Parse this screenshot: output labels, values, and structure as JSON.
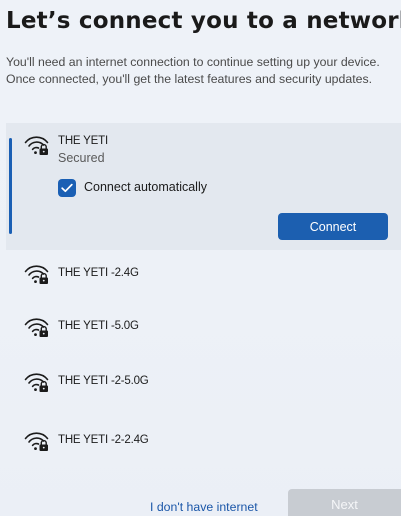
{
  "page": {
    "title": "Let’s connect you to a network",
    "subtitle": "You'll need an internet connection to continue setting up your device. Once connected, you'll get the latest features and security updates."
  },
  "selected_network": {
    "name": "THE YETI",
    "status": "Secured",
    "auto_connect_label": "Connect automatically",
    "auto_connect_checked": true,
    "connect_label": "Connect",
    "icon": "wifi-secured-icon"
  },
  "networks": [
    {
      "name": "THE YETI -2.4G",
      "icon": "wifi-secured-icon"
    },
    {
      "name": "THE YETI -5.0G",
      "icon": "wifi-secured-icon"
    },
    {
      "name": "THE YETI -2-5.0G",
      "icon": "wifi-secured-icon"
    },
    {
      "name": "THE YETI -2-2.4G",
      "icon": "wifi-secured-icon"
    }
  ],
  "footer": {
    "no_internet_label": "I don't have internet",
    "next_label": "Next"
  },
  "colors": {
    "accent": "#1a5fb4",
    "link": "#1a56a8",
    "disabled_button": "#c8ccd2"
  }
}
